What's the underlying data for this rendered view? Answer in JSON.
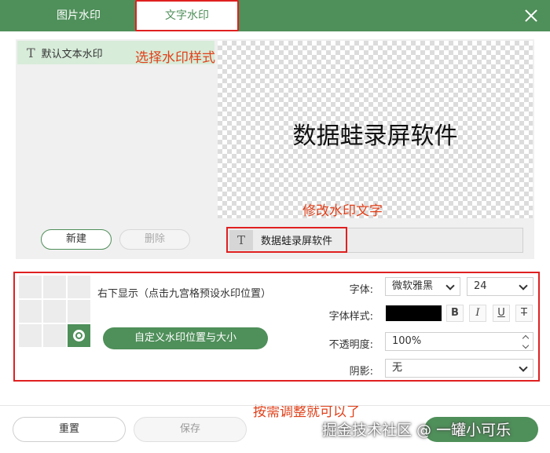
{
  "header": {
    "tabs": [
      {
        "label": "图片水印",
        "active": false
      },
      {
        "label": "文字水印",
        "active": true
      }
    ]
  },
  "style_list": {
    "items": [
      {
        "label": "默认文本水印",
        "selected": true
      }
    ]
  },
  "annotations": {
    "choose_style": "选择水印样式",
    "edit_text": "修改水印文字",
    "adjust": "按需调整就可以了"
  },
  "preview": {
    "text": "数据蛙录屏软件"
  },
  "list_buttons": {
    "new_label": "新建",
    "delete_label": "删除"
  },
  "text_input": {
    "glyph": "T",
    "value": "数据蛙录屏软件"
  },
  "position": {
    "selected_cell": 9,
    "description": "右下显示（点击九宫格预设水印位置）",
    "custom_label": "自定义水印位置与大小"
  },
  "settings": {
    "font_label": "字体:",
    "font_value": "微软雅黑",
    "size_value": "24",
    "style_label": "字体样式:",
    "color": "#000000",
    "bold": "B",
    "italic": "I",
    "underline": "U",
    "strike": "T",
    "opacity_label": "不透明度:",
    "opacity_value": "100%",
    "shadow_label": "阴影:",
    "shadow_value": "无"
  },
  "footer": {
    "reset_label": "重置",
    "save_label": "保存",
    "watermark": "掘金技术社区 @ 一罐小可乐"
  },
  "colors": {
    "accent": "#4f8f5a",
    "highlight": "#e02020",
    "annotation": "#e0401a"
  }
}
